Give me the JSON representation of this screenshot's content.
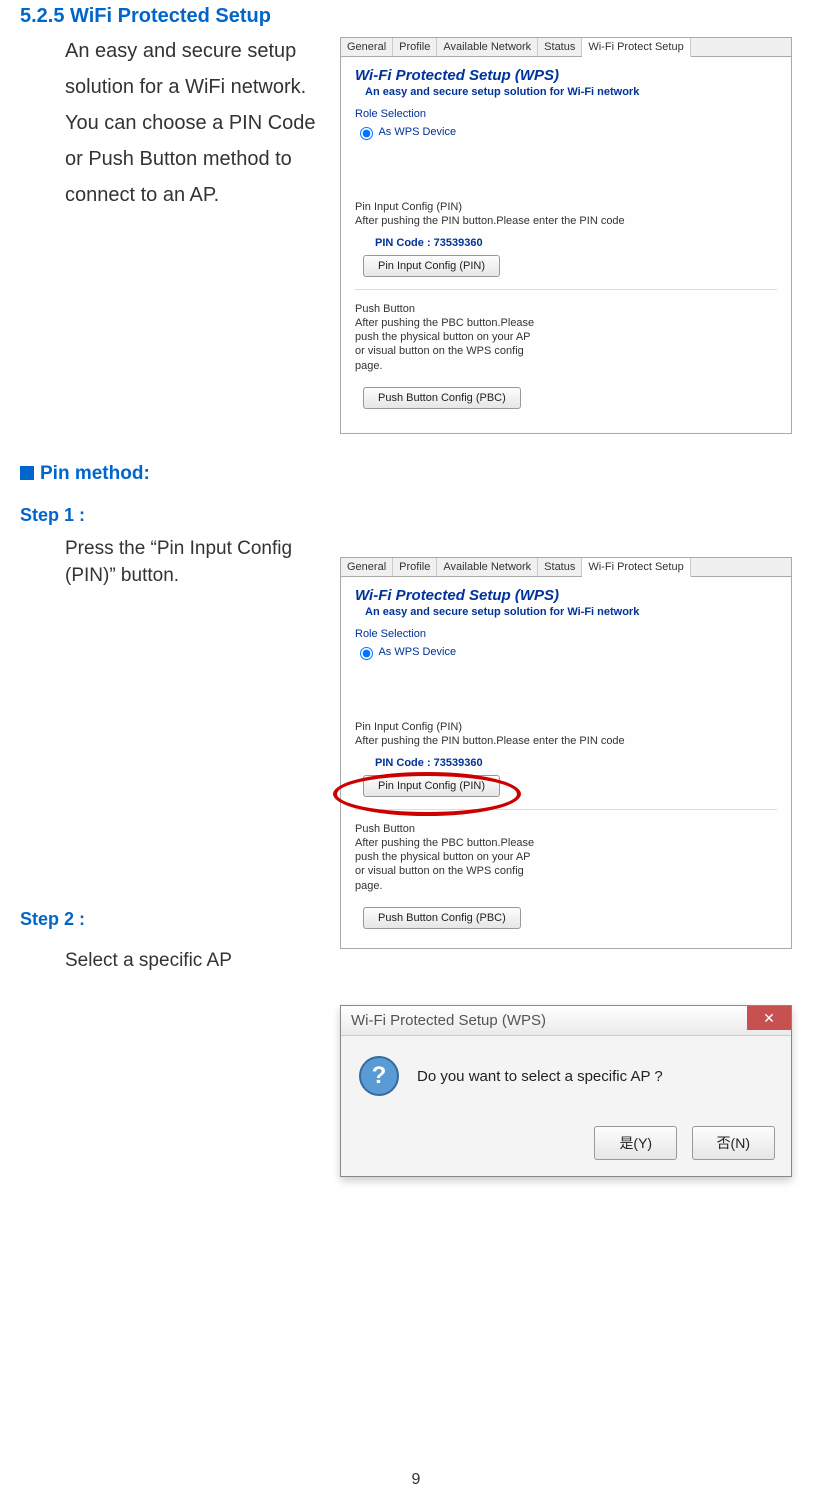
{
  "section": {
    "number_title": "5.2.5 WiFi Protected Setup",
    "intro": "An easy and secure setup solution for a WiFi network. You can choose a PIN Code or Push Button method to connect to an AP."
  },
  "pin_method": {
    "heading": "Pin method:",
    "step1_label": "Step 1 :",
    "step1_text": "Press the “Pin Input Config (PIN)” button.",
    "step2_label": "Step 2 :",
    "step2_text": "Select a specific AP"
  },
  "wps_panel": {
    "tabs": [
      "General",
      "Profile",
      "Available Network",
      "Status",
      "Wi-Fi Protect Setup"
    ],
    "title": "Wi-Fi Protected Setup (WPS)",
    "subtitle": "An easy and secure setup solution for Wi-Fi network",
    "role_label": "Role Selection",
    "radio_label": "As WPS Device",
    "pin_heading": "Pin Input Config (PIN)",
    "pin_desc": "After pushing the PIN button.Please enter the PIN code",
    "pin_code_label": "PIN Code :  73539360",
    "pin_button": "Pin Input Config (PIN)",
    "pbc_heading": "Push Button",
    "pbc_desc": "After pushing the PBC button.Please push the physical button on your AP or visual button on the WPS config page.",
    "pbc_button": "Push Button Config (PBC)"
  },
  "dialog": {
    "title": "Wi-Fi Protected Setup (WPS)",
    "message": "Do you want to select a specific AP ?",
    "yes": "是(Y)",
    "no": "否(N)"
  },
  "page_number": "9"
}
